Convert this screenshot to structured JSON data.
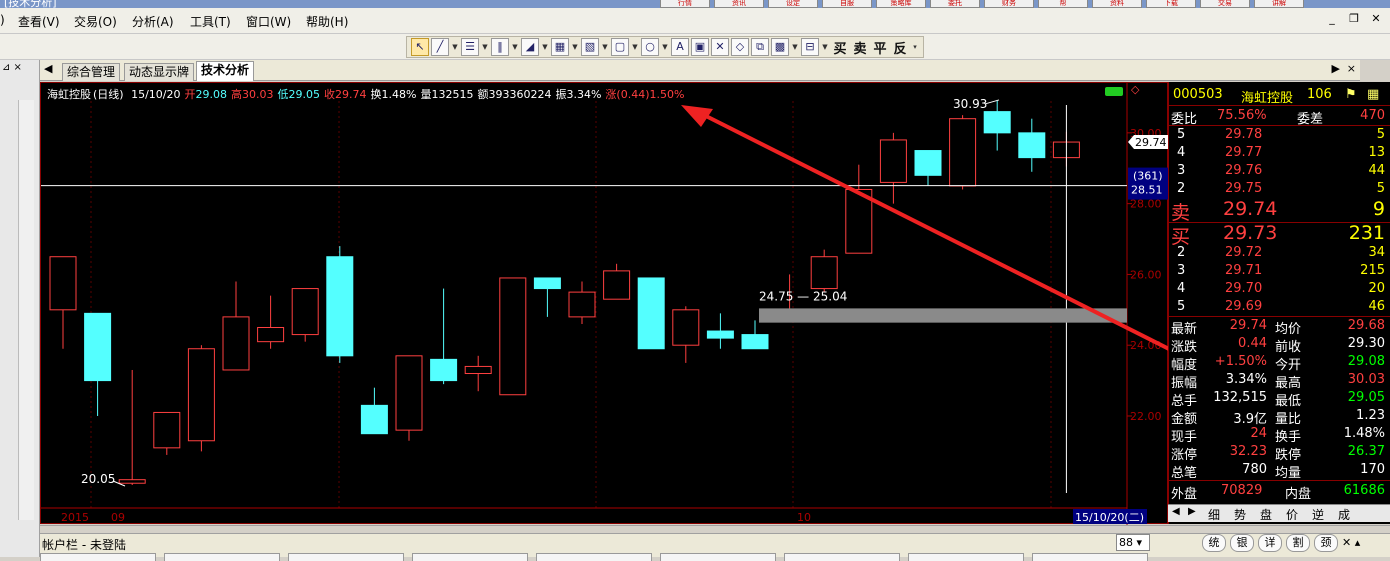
{
  "window": {
    "title": "[技术分析]"
  },
  "top_buttons": [
    "行情",
    "资讯",
    "设定",
    "自服",
    "策略库",
    "委托",
    "财务",
    "帮",
    "资料",
    "下载",
    "交易",
    "讲解"
  ],
  "menu": [
    "查看(V)",
    "交易(O)",
    "分析(A)",
    "工具(T)",
    "窗口(W)",
    "帮助(H)"
  ],
  "toolbar": {
    "chars": [
      "买",
      "卖",
      "平",
      "反"
    ]
  },
  "tabs": [
    "综合管理",
    "动态显示牌",
    "技术分析"
  ],
  "info": {
    "name": "海虹控股",
    "period": "(日线)",
    "date": "15/10/20",
    "open_label": "开",
    "open": "29.08",
    "high_label": "高",
    "high": "30.03",
    "low_label": "低",
    "low": "29.05",
    "close_label": "收",
    "close": "29.74",
    "turnover": "换1.48%",
    "volume": "量132515",
    "amount": "额393360224",
    "amplitude": "振3.34%",
    "change": "涨(0.44)1.50%"
  },
  "chart_data": {
    "type": "candlestick",
    "y_range": [
      19.4,
      30.9
    ],
    "y_ticks": [
      "30.00",
      "28.00",
      "26.00",
      "24.00",
      "22.00"
    ],
    "x_labels": [
      "2015",
      "09",
      "10"
    ],
    "candles": [
      {
        "o": 25.0,
        "h": 25.7,
        "l": 23.9,
        "c": 26.5
      },
      {
        "o": 24.9,
        "h": 24.9,
        "l": 22.0,
        "c": 23.0
      },
      {
        "o": 20.1,
        "h": 23.3,
        "l": 20.05,
        "c": 20.2
      },
      {
        "o": 21.1,
        "h": 22.0,
        "l": 20.9,
        "c": 22.1
      },
      {
        "o": 21.3,
        "h": 24.0,
        "l": 21.0,
        "c": 23.9
      },
      {
        "o": 23.3,
        "h": 25.8,
        "l": 23.3,
        "c": 24.8
      },
      {
        "o": 24.1,
        "h": 25.4,
        "l": 23.9,
        "c": 24.5
      },
      {
        "o": 24.3,
        "h": 25.3,
        "l": 24.1,
        "c": 25.6
      },
      {
        "o": 26.5,
        "h": 26.8,
        "l": 23.5,
        "c": 23.7
      },
      {
        "o": 22.3,
        "h": 22.8,
        "l": 21.6,
        "c": 21.5
      },
      {
        "o": 21.6,
        "h": 23.6,
        "l": 21.3,
        "c": 23.7
      },
      {
        "o": 23.6,
        "h": 25.6,
        "l": 22.9,
        "c": 23.0
      },
      {
        "o": 23.2,
        "h": 23.7,
        "l": 22.7,
        "c": 23.4
      },
      {
        "o": 22.6,
        "h": 25.9,
        "l": 22.6,
        "c": 25.9
      },
      {
        "o": 25.9,
        "h": 25.2,
        "l": 24.8,
        "c": 25.6
      },
      {
        "o": 24.8,
        "h": 25.8,
        "l": 24.6,
        "c": 25.5
      },
      {
        "o": 25.3,
        "h": 26.3,
        "l": 25.6,
        "c": 26.1
      },
      {
        "o": 25.9,
        "h": 25.9,
        "l": 23.9,
        "c": 23.9
      },
      {
        "o": 24.0,
        "h": 25.1,
        "l": 23.5,
        "c": 25.0
      },
      {
        "o": 24.4,
        "h": 24.9,
        "l": 23.9,
        "c": 24.2
      },
      {
        "o": 24.3,
        "h": 24.7,
        "l": 23.9,
        "c": 23.9
      },
      {
        "o": 25.0,
        "h": 26.0,
        "l": 24.8,
        "c": 25.0
      },
      {
        "o": 25.6,
        "h": 26.7,
        "l": 25.5,
        "c": 26.5
      },
      {
        "o": 26.6,
        "h": 29.1,
        "l": 26.6,
        "c": 28.4
      },
      {
        "o": 28.6,
        "h": 30.0,
        "l": 28.0,
        "c": 29.8
      },
      {
        "o": 29.5,
        "h": 29.5,
        "l": 28.5,
        "c": 28.8
      },
      {
        "o": 28.5,
        "h": 30.5,
        "l": 28.4,
        "c": 30.4
      },
      {
        "o": 30.6,
        "h": 30.93,
        "l": 29.5,
        "c": 30.0
      },
      {
        "o": 30.0,
        "h": 30.4,
        "l": 28.9,
        "c": 29.3
      },
      {
        "o": 29.3,
        "h": 30.03,
        "l": 29.05,
        "c": 29.74
      }
    ],
    "annotations": {
      "low_label": "20.05",
      "high_label": "30.93",
      "range_label": "24.75 — 25.04",
      "hline_value": "28.51",
      "cursor_count": "(361)",
      "current_price": "29.74",
      "cursor_date": "15/10/20(二)"
    }
  },
  "quote": {
    "code": "000503",
    "name": "海虹控股",
    "num": "106",
    "weibi_label": "委比",
    "weibi": "75.56%",
    "weicha_label": "委差",
    "weicha": "470",
    "sell": [
      {
        "level": "5",
        "price": "29.78",
        "vol": "5"
      },
      {
        "level": "4",
        "price": "29.77",
        "vol": "13"
      },
      {
        "level": "3",
        "price": "29.76",
        "vol": "44"
      },
      {
        "level": "2",
        "price": "29.75",
        "vol": "5"
      }
    ],
    "sell1_label": "卖",
    "sell1_price": "29.74",
    "sell1_vol": "9",
    "buy1_label": "买",
    "buy1_price": "29.73",
    "buy1_vol": "231",
    "buy": [
      {
        "level": "2",
        "price": "29.72",
        "vol": "34"
      },
      {
        "level": "3",
        "price": "29.71",
        "vol": "215"
      },
      {
        "level": "4",
        "price": "29.70",
        "vol": "20"
      },
      {
        "level": "5",
        "price": "29.69",
        "vol": "46"
      }
    ],
    "stats": [
      {
        "l1": "最新",
        "v1": "29.74",
        "c1": "#ff4040",
        "l2": "均价",
        "v2": "29.68",
        "c2": "#ff4040"
      },
      {
        "l1": "涨跌",
        "v1": "0.44",
        "c1": "#ff4040",
        "l2": "前收",
        "v2": "29.30",
        "c2": "#ffffff"
      },
      {
        "l1": "幅度",
        "v1": "+1.50%",
        "c1": "#ff4040",
        "l2": "今开",
        "v2": "29.08",
        "c2": "#00ff00"
      },
      {
        "l1": "振幅",
        "v1": "3.34%",
        "c1": "#ffffff",
        "l2": "最高",
        "v2": "30.03",
        "c2": "#ff4040"
      },
      {
        "l1": "总手",
        "v1": "132,515",
        "c1": "#ffffff",
        "l2": "最低",
        "v2": "29.05",
        "c2": "#00ff00"
      },
      {
        "l1": "金额",
        "v1": "3.9亿",
        "c1": "#ffffff",
        "l2": "量比",
        "v2": "1.23",
        "c2": "#ffffff"
      },
      {
        "l1": "现手",
        "v1": "24",
        "c1": "#ff4040",
        "l2": "换手",
        "v2": "1.48%",
        "c2": "#ffffff"
      },
      {
        "l1": "涨停",
        "v1": "32.23",
        "c1": "#ff4040",
        "l2": "跌停",
        "v2": "26.37",
        "c2": "#00ff00"
      },
      {
        "l1": "总笔",
        "v1": "780",
        "c1": "#ffffff",
        "l2": "均量",
        "v2": "170",
        "c2": "#ffffff"
      }
    ],
    "outer_label": "外盘",
    "outer": "70829",
    "inner_label": "内盘",
    "inner": "61686"
  },
  "right_tabs": [
    "细",
    "势",
    "盘",
    "价",
    "逆",
    "成"
  ],
  "account": {
    "label": "帐户栏 - 未登陆",
    "select": "88",
    "buttons": [
      "统",
      "银",
      "详",
      "割",
      "颈"
    ]
  },
  "colors": {
    "up": "#ff4040",
    "down": "#54ffff",
    "text_yellow": "#ffff00"
  }
}
